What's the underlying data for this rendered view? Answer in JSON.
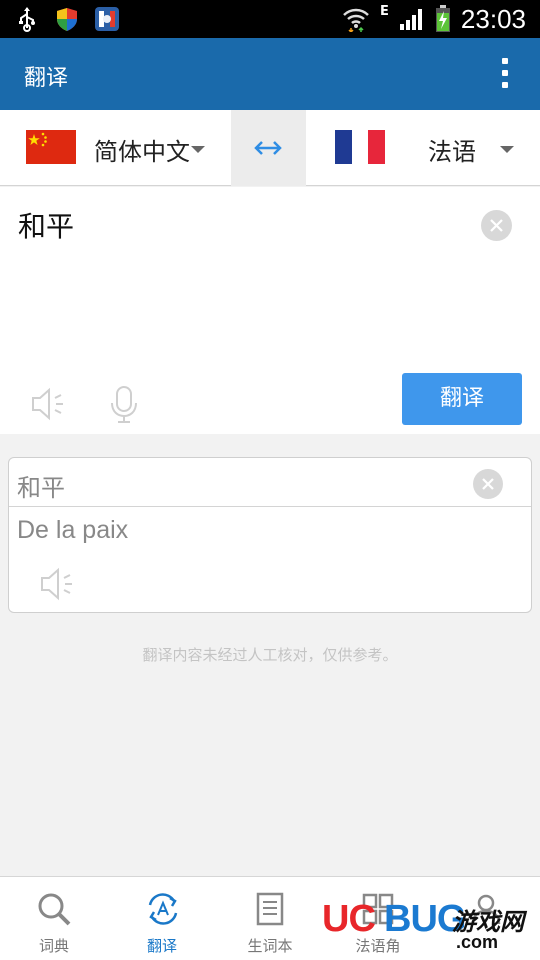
{
  "status_bar": {
    "time": "23:03",
    "network_type": "E",
    "icons": [
      "usb-icon",
      "shield-icon",
      "app-notification-icon",
      "wifi-icon",
      "signal-icon",
      "battery-charging-icon"
    ]
  },
  "app_bar": {
    "title": "翻译",
    "menu_icon": "overflow-menu-icon"
  },
  "language_bar": {
    "source_language": "简体中文",
    "target_language": "法语",
    "swap_icon": "swap-arrows-icon",
    "source_flag": "china-flag-icon",
    "target_flag": "france-flag-icon"
  },
  "input": {
    "text": "和平",
    "translate_button_label": "翻译"
  },
  "result": {
    "source_text": "和平",
    "translated_text": "De la paix"
  },
  "disclaimer": "翻译内容未经过人工核对，仅供参考。",
  "bottom_nav": {
    "items": [
      {
        "label": "词典",
        "icon": "search-icon",
        "active": false
      },
      {
        "label": "翻译",
        "icon": "translate-icon",
        "active": true
      },
      {
        "label": "生词本",
        "icon": "notebook-icon",
        "active": false
      },
      {
        "label": "法语角",
        "icon": "grid-icon",
        "active": false
      },
      {
        "label": "",
        "icon": "profile-icon",
        "active": false
      }
    ]
  },
  "watermark": {
    "brand_red": "UC",
    "brand_blue": "BUG",
    "brand_cn": "游戏网",
    "domain": ".com"
  },
  "colors": {
    "app_bar": "#1a6aab",
    "translate_button": "#3f97ec",
    "active_nav": "#1a78c8"
  }
}
